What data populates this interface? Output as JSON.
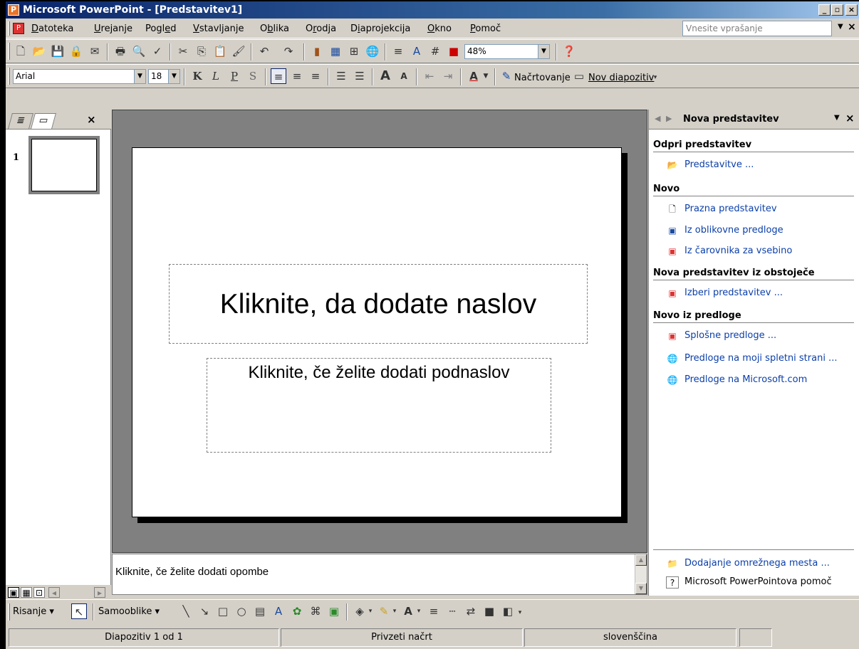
{
  "window": {
    "title": "Microsoft PowerPoint - [Predstavitev1]",
    "caption_buttons": [
      "_",
      "▫",
      "×"
    ]
  },
  "menu": {
    "items": [
      {
        "label": "Datoteka",
        "u": 0
      },
      {
        "label": "Urejanje",
        "u": 0
      },
      {
        "label": "Pogled",
        "u": 4
      },
      {
        "label": "Vstavljanje",
        "u": 0
      },
      {
        "label": "Oblika",
        "u": 1
      },
      {
        "label": "Orodja",
        "u": 1
      },
      {
        "label": "Diaprojekcija",
        "u": 1
      },
      {
        "label": "Okno",
        "u": 0
      },
      {
        "label": "Pomoč",
        "u": 0
      }
    ],
    "ask_placeholder": "Vnesite vprašanje"
  },
  "standard_toolbar": {
    "zoom": "48%",
    "icons": [
      "new-icon",
      "open-icon",
      "save-icon",
      "permission-icon",
      "email-icon",
      "print-icon",
      "print-preview-icon",
      "spelling-icon",
      "cut-icon",
      "copy-icon",
      "paste-icon",
      "format-painter-icon",
      "undo-icon",
      "redo-icon",
      "insert-chart-icon",
      "insert-table-icon",
      "tables-borders-icon",
      "hyperlink-icon",
      "expand-icon",
      "show-formatting-icon",
      "grid-icon",
      "color-icon",
      "help-icon"
    ]
  },
  "formatting_toolbar": {
    "font": "Arial",
    "size": "18",
    "bold": "K",
    "italic": "L",
    "underline": "P",
    "shadow": "S",
    "design_label": "Načrtovanje",
    "new_slide_label": "Nov diapozitiv"
  },
  "left_panel": {
    "slide_number": "1"
  },
  "slide": {
    "title_placeholder": "Kliknite, da dodate naslov",
    "subtitle_placeholder": "Kliknite, če želite dodati podnaslov"
  },
  "notes": {
    "placeholder": "Kliknite, če želite dodati opombe"
  },
  "task_pane": {
    "title": "Nova predstavitev",
    "sections": {
      "open": "Odpri predstavitev",
      "new": "Novo",
      "from_existing": "Nova predstavitev iz obstoječe",
      "from_template": "Novo iz predloge"
    },
    "links": {
      "presentations": "Predstavitve ...",
      "blank": "Prazna predstavitev",
      "design_template": "Iz oblikovne predloge",
      "autocontent": "Iz čarovnika za vsebino",
      "choose": "Izberi predstavitev ...",
      "general_templates": "Splošne predloge ...",
      "web_templates": "Predloge na moji spletni strani ...",
      "ms_templates": "Predloge na Microsoft.com",
      "add_network_place": "Dodajanje omrežnega mesta ...",
      "help": "Microsoft PowerPointova pomoč"
    }
  },
  "drawing_toolbar": {
    "draw_label": "Risanje",
    "autoshapes_label": "Samooblike"
  },
  "status_bar": {
    "slide_info": "Diapozitiv 1 od 1",
    "design": "Privzeti načrt",
    "language": "slovenščina"
  },
  "colors": {
    "title_bar": "#0a246a",
    "link": "#0b3fa9",
    "face": "#d4d0c8"
  }
}
